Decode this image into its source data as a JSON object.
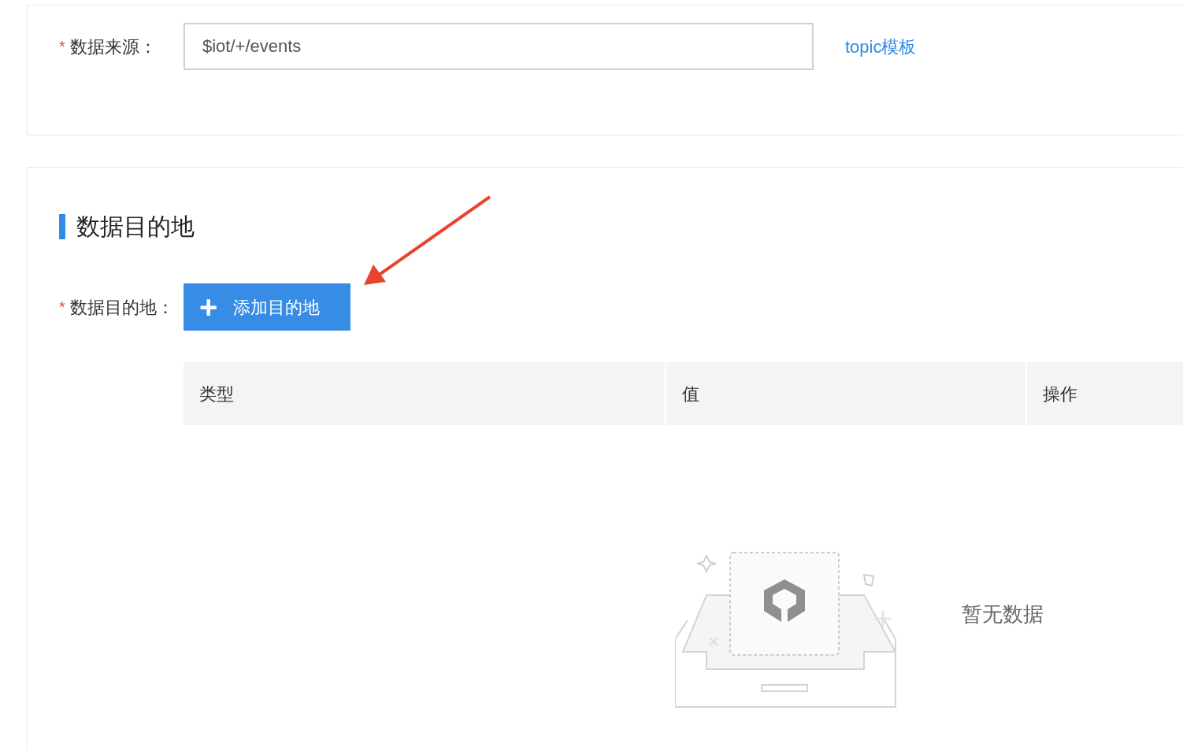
{
  "source_field": {
    "required_mark": "*",
    "label": "数据来源：",
    "value": "$iot/+/events",
    "link": "topic模板"
  },
  "destination_section": {
    "title": "数据目的地",
    "required_mark": "*",
    "label": "数据目的地：",
    "add_button": {
      "icon": "+",
      "label": "添加目的地"
    },
    "table": {
      "columns": [
        "类型",
        "值",
        "操作"
      ],
      "empty_text": "暂无数据"
    }
  },
  "annotation": {
    "kind": "arrow"
  }
}
